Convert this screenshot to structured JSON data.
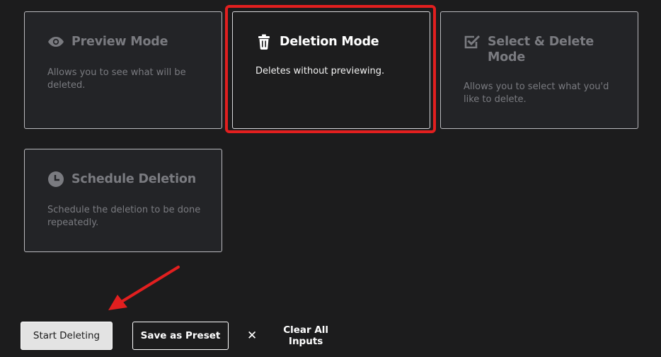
{
  "modes": [
    {
      "key": "preview",
      "icon": "eye-icon",
      "title": "Preview Mode",
      "description": "Allows you to see what will be deleted."
    },
    {
      "key": "deletion",
      "icon": "trash-icon",
      "title": "Deletion Mode",
      "description": "Deletes without previewing."
    },
    {
      "key": "select_delete",
      "icon": "checkbox-icon",
      "title": "Select & Delete Mode",
      "description": "Allows you to select what you'd like to delete."
    },
    {
      "key": "schedule",
      "icon": "clock-icon",
      "title": "Schedule Deletion",
      "description": "Schedule the deletion to be done repeatedly."
    }
  ],
  "selected_mode": "Deletion Mode",
  "actions": {
    "start_label": "Start Deleting",
    "preset_label": "Save as Preset",
    "clear_label": "Clear All Inputs",
    "clear_icon": "close-icon"
  },
  "colors": {
    "background": "#1c1c1d",
    "card_background": "#232427",
    "muted_text": "#7a7b80",
    "highlight": "#e21f1f"
  }
}
